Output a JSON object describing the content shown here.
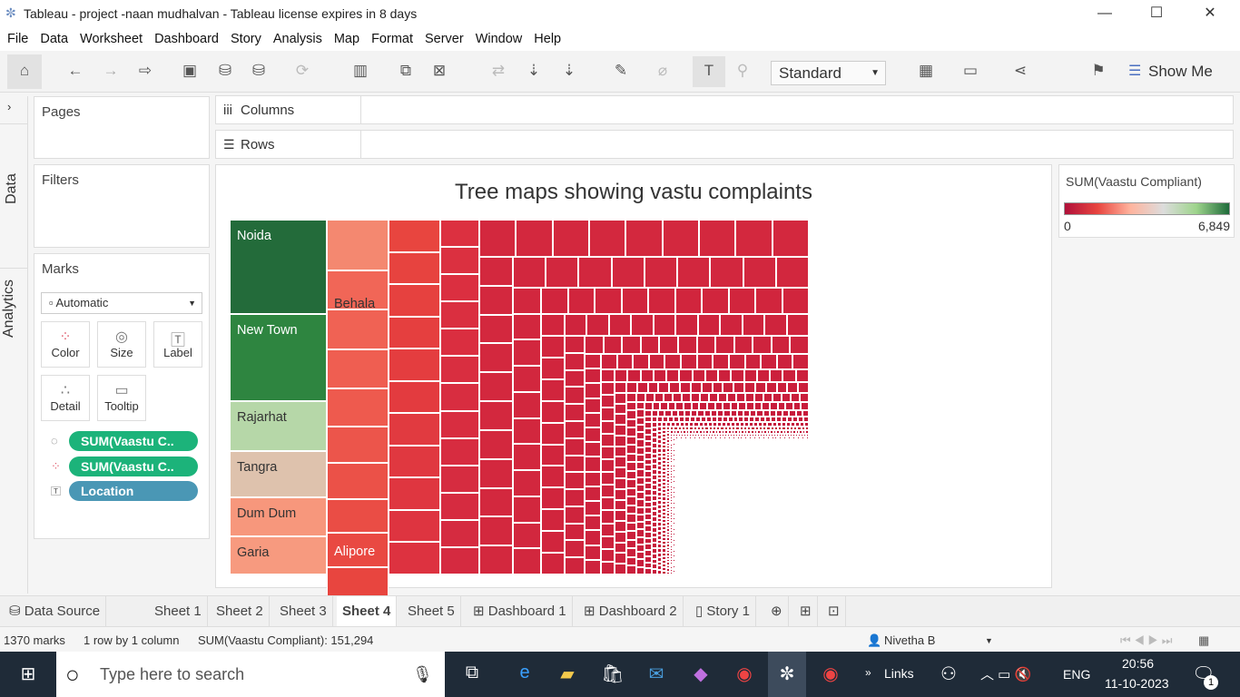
{
  "window": {
    "title": "Tableau - project -naan mudhalvan - Tableau license expires in 8 days",
    "minimize": "—",
    "maximize": "☐",
    "close": "✕"
  },
  "menu": [
    "File",
    "Data",
    "Worksheet",
    "Dashboard",
    "Story",
    "Analysis",
    "Map",
    "Format",
    "Server",
    "Window",
    "Help"
  ],
  "toolbar": {
    "fit_select": "Standard",
    "show_me": "Show Me"
  },
  "left_tabs": {
    "data": "Data",
    "analytics": "Analytics"
  },
  "cards": {
    "pages": "Pages",
    "filters": "Filters",
    "marks": "Marks",
    "mark_type": "Automatic",
    "buttons": [
      "Color",
      "Size",
      "Label",
      "Detail",
      "Tooltip"
    ],
    "pills": [
      {
        "icon": "size-icon",
        "label": "SUM(Vaastu C..",
        "color": "#1cb37a"
      },
      {
        "icon": "color-icon",
        "label": "SUM(Vaastu C..",
        "color": "#1cb37a"
      },
      {
        "icon": "label-icon",
        "label": "Location",
        "color": "#4a97b5"
      }
    ]
  },
  "shelves": {
    "columns": "Columns",
    "rows": "Rows"
  },
  "view": {
    "title": "Tree maps showing vastu complaints",
    "labeled_tiles": [
      {
        "label": "Noida",
        "color": "#236b3a"
      },
      {
        "label": "New Town",
        "color": "#2e8540"
      },
      {
        "label": "Rajarhat",
        "color": "#b6d7a8"
      },
      {
        "label": "Tangra",
        "color": "#dec2ad"
      },
      {
        "label": "Dum Dum",
        "color": "#f7977c"
      },
      {
        "label": "Garia",
        "color": "#f79a7f"
      },
      {
        "label": "Behala",
        "color": "#f48870"
      },
      {
        "label": "Alipore",
        "color": "#ef6655"
      }
    ],
    "low_color": "#c4173b",
    "mid_color": "#e8453f"
  },
  "legend": {
    "title": "SUM(Vaastu Compliant)",
    "min": "0",
    "max": "6,849",
    "colors": [
      "#b0103a",
      "#e8453f",
      "#ffb49e",
      "#dcdcdc",
      "#9ed48c",
      "#1e6b3a"
    ]
  },
  "tabs": {
    "data_source": "Data Source",
    "sheets": [
      "Sheet 1",
      "Sheet 2",
      "Sheet 3",
      "Sheet 4",
      "Sheet 5",
      "Dashboard 1",
      "Dashboard 2",
      "Story 1"
    ],
    "active": "Sheet 4"
  },
  "status": {
    "marks": "1370 marks",
    "dims": "1 row by 1 column",
    "sum": "SUM(Vaastu Compliant): 151,294",
    "user": "Nivetha B"
  },
  "taskbar": {
    "search_placeholder": "Type here to search",
    "links": "Links",
    "lang": "ENG",
    "time": "20:56",
    "date": "11-10-2023",
    "notif": "1"
  }
}
